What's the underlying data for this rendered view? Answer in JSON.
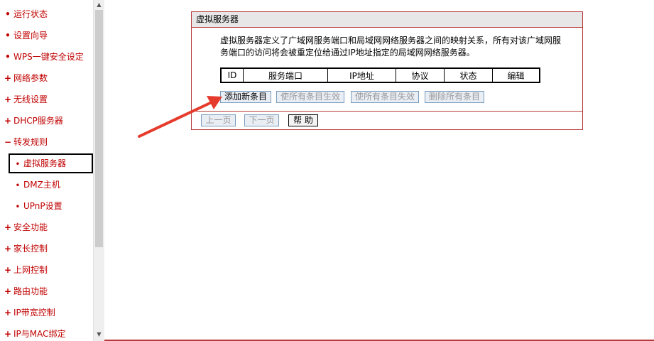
{
  "sidebar": {
    "items": [
      {
        "marker": "•",
        "label": "运行状态",
        "sub": false,
        "selected": false
      },
      {
        "marker": "•",
        "label": "设置向导",
        "sub": false,
        "selected": false
      },
      {
        "marker": "•",
        "label": "WPS一键安全设定",
        "sub": false,
        "selected": false
      },
      {
        "marker": "+",
        "label": "网络参数",
        "sub": false,
        "selected": false
      },
      {
        "marker": "+",
        "label": "无线设置",
        "sub": false,
        "selected": false
      },
      {
        "marker": "+",
        "label": "DHCP服务器",
        "sub": false,
        "selected": false
      },
      {
        "marker": "−",
        "label": "转发规则",
        "sub": false,
        "selected": false
      },
      {
        "marker": "•",
        "label": "虚拟服务器",
        "sub": true,
        "selected": true
      },
      {
        "marker": "•",
        "label": "DMZ主机",
        "sub": true,
        "selected": false
      },
      {
        "marker": "•",
        "label": "UPnP设置",
        "sub": true,
        "selected": false
      },
      {
        "marker": "+",
        "label": "安全功能",
        "sub": false,
        "selected": false
      },
      {
        "marker": "+",
        "label": "家长控制",
        "sub": false,
        "selected": false
      },
      {
        "marker": "+",
        "label": "上网控制",
        "sub": false,
        "selected": false
      },
      {
        "marker": "+",
        "label": "路由功能",
        "sub": false,
        "selected": false
      },
      {
        "marker": "+",
        "label": "IP带宽控制",
        "sub": false,
        "selected": false
      },
      {
        "marker": "+",
        "label": "IP与MAC绑定",
        "sub": false,
        "selected": false
      }
    ]
  },
  "panel": {
    "title": "虚拟服务器",
    "description": "虚拟服务器定义了广域网服务端口和局域网网络服务器之间的映射关系，所有对该广域网服务端口的访问将会被重定位给通过IP地址指定的局域网网络服务器。",
    "table": {
      "headers": [
        "ID",
        "服务端口",
        "IP地址",
        "协议",
        "状态",
        "编辑"
      ]
    },
    "buttons": {
      "add_new": "添加新条目",
      "enable_all": "使所有条目生效",
      "disable_all": "使所有条目失效",
      "delete_all": "删除所有条目",
      "prev_page": "上一页",
      "next_page": "下一页",
      "help": "帮 助"
    }
  },
  "colors": {
    "accent_red": "#c00000",
    "panel_border": "#b83b3b",
    "arrow": "#e53b2c"
  },
  "icons": {
    "scroll_up": "arrow-up-icon",
    "scroll_down": "arrow-down-icon",
    "annotation": "red-arrow-icon"
  }
}
